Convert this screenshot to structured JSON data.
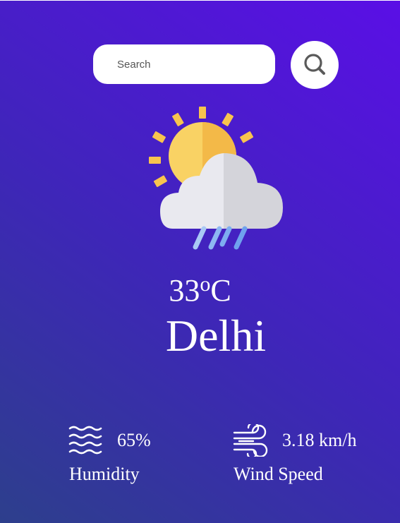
{
  "search": {
    "placeholder": "Search"
  },
  "weather": {
    "icon": "sun-cloud-rain-icon",
    "temperature": "33",
    "temperature_unit": "o",
    "temperature_scale": "C",
    "city": "Delhi"
  },
  "stats": {
    "humidity": {
      "value": "65%",
      "label": "Humidity",
      "icon": "waves-icon"
    },
    "wind": {
      "value": "3.18 km/h",
      "label": "Wind Speed",
      "icon": "wind-icon"
    }
  },
  "colors": {
    "gradient_start": "#2d3f8c",
    "gradient_mid": "#3e26b8",
    "gradient_end": "#5a0fe6",
    "sun": "#f8c44e",
    "cloud": "#e8e8ee",
    "rain": "#6fa8f0"
  }
}
